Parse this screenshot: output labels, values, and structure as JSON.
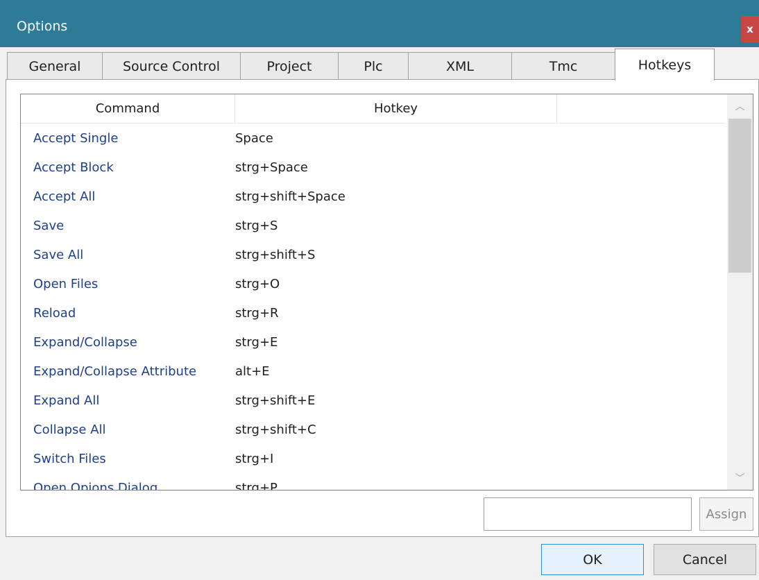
{
  "window": {
    "title": "Options",
    "close_glyph": "x"
  },
  "tabs": [
    {
      "label": "General"
    },
    {
      "label": "Source Control"
    },
    {
      "label": "Project"
    },
    {
      "label": "Plc"
    },
    {
      "label": "XML"
    },
    {
      "label": "Tmc"
    },
    {
      "label": "Hotkeys",
      "active": true
    }
  ],
  "table": {
    "columns": [
      "Command",
      "Hotkey",
      ""
    ],
    "rows": [
      {
        "command": "Accept Single",
        "hotkey": "Space"
      },
      {
        "command": "Accept Block",
        "hotkey": "strg+Space"
      },
      {
        "command": "Accept All",
        "hotkey": "strg+shift+Space"
      },
      {
        "command": "Save",
        "hotkey": "strg+S"
      },
      {
        "command": "Save All",
        "hotkey": "strg+shift+S"
      },
      {
        "command": "Open Files",
        "hotkey": "strg+O"
      },
      {
        "command": "Reload",
        "hotkey": "strg+R"
      },
      {
        "command": "Expand/Collapse",
        "hotkey": "strg+E"
      },
      {
        "command": "Expand/Collapse Attribute",
        "hotkey": "alt+E"
      },
      {
        "command": "Expand All",
        "hotkey": "strg+shift+E"
      },
      {
        "command": "Collapse All",
        "hotkey": "strg+shift+C"
      },
      {
        "command": "Switch Files",
        "hotkey": "strg+I"
      },
      {
        "command": "Open Opions Dialog",
        "hotkey": "strg+P"
      }
    ]
  },
  "scrollbar": {
    "up_glyph": "︿",
    "down_glyph": "﹀"
  },
  "assign": {
    "input_value": "",
    "button_label": "Assign"
  },
  "buttons": {
    "ok": "OK",
    "cancel": "Cancel"
  },
  "colors": {
    "titlebar": "#2e7b97",
    "close": "#c74646",
    "command_text": "#1e3f8a",
    "ok_border": "#2b8fd8"
  }
}
